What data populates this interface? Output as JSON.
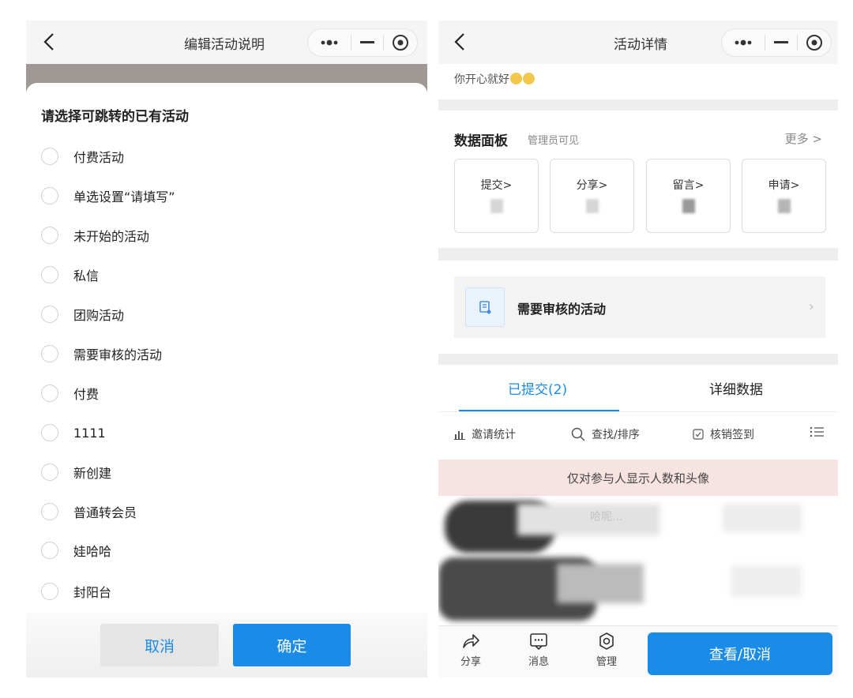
{
  "left": {
    "title": "编辑活动说明",
    "sheet_title": "请选择可跳转的已有活动",
    "options": [
      "付费活动",
      "单选设置“请填写”",
      "未开始的活动",
      "私信",
      "团购活动",
      "需要审核的活动",
      "付费",
      "1111",
      "新创建",
      "普通转会员",
      "娃哈哈",
      "封阳台"
    ],
    "cancel_label": "取消",
    "confirm_label": "确定"
  },
  "right": {
    "title": "活动详情",
    "intro_text": "你开心就好",
    "panel": {
      "title": "数据面板",
      "subtitle": "管理员可见",
      "more": "更多 >",
      "stats": [
        "提交>",
        "分享>",
        "留言>",
        "申请>"
      ]
    },
    "review_item": "需要审核的活动",
    "tabs": [
      "已提交(2)",
      "详细数据"
    ],
    "toolbar": [
      "邀请统计",
      "查找/排序",
      "核销签到"
    ],
    "notice": "仅对参与人显示人数和头像",
    "snippet": "哈呢...",
    "bottom_nav": [
      "分享",
      "消息",
      "管理"
    ],
    "primary_button": "查看/取消"
  },
  "colors": {
    "accent": "#1a8ce8",
    "notice_bg": "#f8e3e3",
    "overlay": "#9f9895"
  }
}
